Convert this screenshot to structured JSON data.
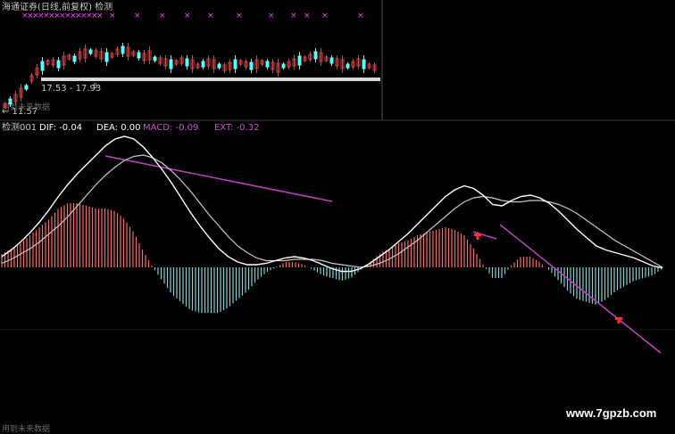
{
  "header": {
    "title": "海通证券(日线,前复权) 检测"
  },
  "price_panel": {
    "range_label": "17.53 - 17.93",
    "range_suffix": "6",
    "low_marker": "← 11.57",
    "future_data_label": "用到未来数据"
  },
  "indicator_header": {
    "name": "检测001",
    "dif": "DIF: -0.04",
    "dea": "DEA: 0.00",
    "macd": "MACD: -0.09",
    "ext": "EXT: -0.32"
  },
  "footer": {
    "future_data_label": "用到未来数据",
    "watermark": "www.7gpzb.com"
  },
  "colors": {
    "background": "#000000",
    "dif_line": "#ffffff",
    "dea_line": "#c8c8c8",
    "macd_positive": "#ff6a6a",
    "macd_negative": "#7fd4d4",
    "ext_line": "#c040c0",
    "buy_marker": "#ff3030",
    "sell_marker": "#ff40ff",
    "candle_up": "#ff3030",
    "candle_down": "#54ffff"
  },
  "chart_data": {
    "type": "line",
    "series": [
      {
        "name": "DIF",
        "values": [
          0.8,
          1.3,
          1.9,
          2.6,
          3.4,
          4.3,
          5.3,
          6.2,
          7.0,
          7.7,
          8.4,
          9.1,
          9.6,
          9.8,
          9.6,
          9.0,
          8.2,
          7.3,
          6.3,
          5.2,
          4.1,
          3.1,
          2.2,
          1.4,
          0.8,
          0.4,
          0.2,
          0.2,
          0.3,
          0.5,
          0.7,
          0.8,
          0.7,
          0.5,
          0.2,
          -0.1,
          -0.3,
          -0.3,
          -0.1,
          0.3,
          0.8,
          1.3,
          1.9,
          2.5,
          3.2,
          3.9,
          4.6,
          5.3,
          5.8,
          6.1,
          5.9,
          5.4,
          4.7,
          4.6,
          5.0,
          5.3,
          5.4,
          5.2,
          4.8,
          4.2,
          3.5,
          2.8,
          2.2,
          1.6,
          1.3,
          1.1,
          0.9,
          0.7,
          0.4,
          0.1,
          -0.04
        ]
      },
      {
        "name": "DEA",
        "values": [
          0.3,
          0.6,
          1.0,
          1.4,
          1.9,
          2.5,
          3.1,
          3.8,
          4.6,
          5.4,
          6.2,
          6.9,
          7.5,
          8.0,
          8.3,
          8.4,
          8.2,
          7.8,
          7.2,
          6.5,
          5.7,
          4.8,
          3.9,
          3.1,
          2.3,
          1.6,
          1.1,
          0.7,
          0.5,
          0.5,
          0.5,
          0.6,
          0.6,
          0.6,
          0.5,
          0.3,
          0.2,
          0.1,
          0.0,
          0.1,
          0.3,
          0.6,
          1.0,
          1.5,
          2.0,
          2.6,
          3.2,
          3.8,
          4.4,
          4.9,
          5.2,
          5.3,
          5.2,
          5.0,
          4.9,
          4.9,
          5.0,
          5.0,
          4.9,
          4.7,
          4.4,
          4.0,
          3.5,
          3.0,
          2.5,
          2.0,
          1.6,
          1.2,
          0.8,
          0.4,
          0.0
        ]
      },
      {
        "name": "MACD",
        "values": [
          1.0,
          1.4,
          1.8,
          2.4,
          3.0,
          3.6,
          4.4,
          4.8,
          4.8,
          4.6,
          4.4,
          4.4,
          4.2,
          3.6,
          2.6,
          1.2,
          0.0,
          -1.0,
          -2.0,
          -2.6,
          -3.2,
          -3.4,
          -3.4,
          -3.4,
          -3.0,
          -2.4,
          -1.8,
          -1.0,
          -0.4,
          0.0,
          0.4,
          0.4,
          0.2,
          -0.2,
          -0.6,
          -0.8,
          -1.0,
          -0.8,
          -0.2,
          0.4,
          1.0,
          1.4,
          1.8,
          2.0,
          2.4,
          2.6,
          2.8,
          3.0,
          2.8,
          2.4,
          1.4,
          0.2,
          -0.8,
          -0.8,
          0.2,
          0.8,
          0.8,
          0.4,
          -0.2,
          -1.0,
          -1.8,
          -2.4,
          -2.6,
          -2.8,
          -2.4,
          -1.8,
          -1.4,
          -1.0,
          -0.8,
          -0.6,
          -0.09
        ]
      }
    ],
    "title": "",
    "xlabel": "",
    "ylabel": "",
    "ylim": [
      -12,
      10
    ],
    "grid": false,
    "legend": "top-left"
  }
}
